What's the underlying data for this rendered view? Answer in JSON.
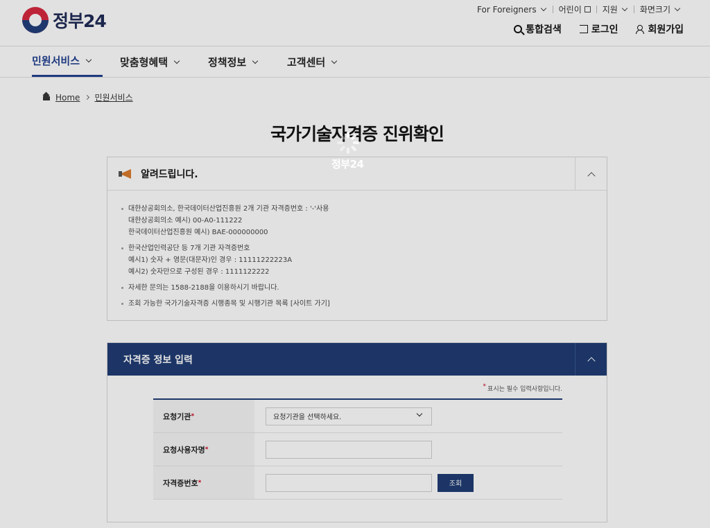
{
  "header": {
    "logo_text": "정부24",
    "util_top": [
      {
        "label": "For Foreigners"
      },
      {
        "label": "어린이"
      },
      {
        "label": "지원"
      },
      {
        "label": "화면크기"
      }
    ],
    "util_main": {
      "search": "통합검색",
      "login": "로그인",
      "signup": "회원가입"
    }
  },
  "gnb": {
    "items": [
      {
        "label": "민원서비스"
      },
      {
        "label": "맞춤형혜택"
      },
      {
        "label": "정책정보"
      },
      {
        "label": "고객센터"
      }
    ]
  },
  "breadcrumb": {
    "home": "Home",
    "current": "민원서비스"
  },
  "page_title": "국가기술자격증 진위확인",
  "notice": {
    "title": "알려드립니다.",
    "items": [
      {
        "l1": "대한상공회의소, 한국데이터산업진흥원 2개 기관 자격증번호 : '-'사용",
        "l2": "대한상공회의소 예시) 00-A0-111222",
        "l3": "한국데이터산업진흥원 예시) BAE-000000000"
      },
      {
        "l1": "한국산업인력공단 등 7개 기관 자격증번호",
        "l2": "예시1) 숫자 + 영문(대문자)인 경우 : 11111222223A",
        "l3": "예시2) 숫자만으로 구성된 경우 : 1111122222"
      },
      {
        "l1": "자세한 문의는 1588-2188을 이용하시기 바랍니다."
      },
      {
        "l1": "조회 가능한 국가기술자격증 시행종목 및 시행기관 목록 [사이트 가기]"
      }
    ]
  },
  "form": {
    "title": "자격증 정보 입력",
    "required_note": "표시는 필수 입력사항입니다.",
    "star": "*",
    "fields": {
      "agency_label": "요청기관",
      "agency_select": "요청기관을 선택하세요.",
      "user_label": "요청사용자명",
      "user_value": "",
      "cert_label": "자격증번호",
      "cert_value": "",
      "search_button": "조회"
    }
  },
  "loading": {
    "label": "정부24"
  },
  "colors": {
    "primary": "#1d3a72",
    "accent": "#1f3f8f",
    "required": "#d0021b"
  }
}
